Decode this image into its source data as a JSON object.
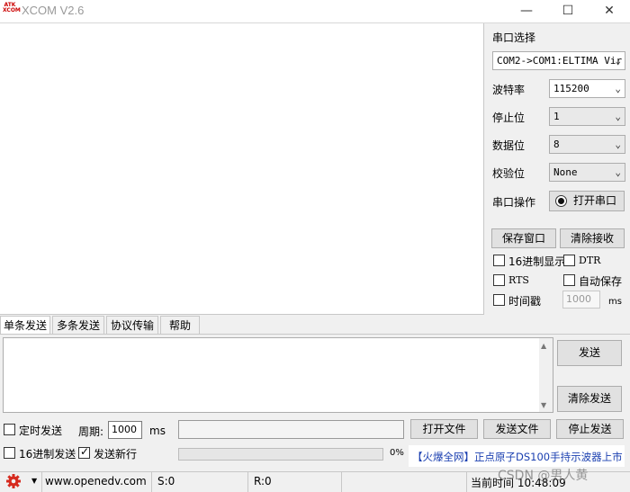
{
  "window": {
    "logo_text": "ATK XCOM",
    "title": "XCOM V2.6",
    "min_glyph": "—",
    "max_glyph": "☐",
    "close_glyph": "✕"
  },
  "serial_panel": {
    "port_select_label": "串口选择",
    "port_value": "COM2->COM1:ELTIMA Vir",
    "baud_label": "波特率",
    "baud_value": "115200",
    "stop_bits_label": "停止位",
    "stop_bits_value": "1",
    "data_bits_label": "数据位",
    "data_bits_value": "8",
    "parity_label": "校验位",
    "parity_value": "None",
    "port_op_label": "串口操作",
    "open_port_button": "打开串口",
    "save_window_button": "保存窗口",
    "clear_receive_button": "清除接收",
    "hex_display_label": "16进制显示",
    "dtr_label": "DTR",
    "rts_label": "RTS",
    "auto_save_label": "自动保存",
    "timestamp_label": "时间戳",
    "timestamp_value": "1000",
    "timestamp_unit": "ms"
  },
  "tabs": [
    "单条发送",
    "多条发送",
    "协议传输",
    "帮助"
  ],
  "send_panel": {
    "send_button": "发送",
    "clear_send_button": "清除发送",
    "timed_send_label": "定时发送",
    "period_label": "周期:",
    "period_value": "1000",
    "period_unit": "ms",
    "open_file_button": "打开文件",
    "send_file_button": "发送文件",
    "stop_send_button": "停止发送",
    "hex_send_label": "16进制发送",
    "send_newline_label": "发送新行",
    "send_newline_checked": true,
    "progress_text": "0%",
    "progress": 0,
    "ad_text": "【火爆全网】正点原子DS100手持示波器上市"
  },
  "status_bar": {
    "website": "www.openedv.com",
    "sent": "S:0",
    "received": "R:0",
    "time_text": "当前时间 10:48:09",
    "watermark": "CSDN @男人黄"
  },
  "colors": {
    "gear_icon": "#d62b1f",
    "ad_blue": "#1a3fb0"
  }
}
